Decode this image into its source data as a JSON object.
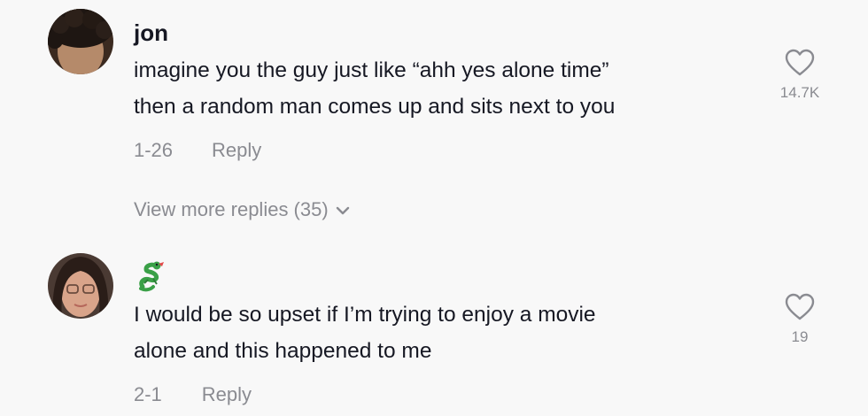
{
  "comments": [
    {
      "username": "jon",
      "text_lines": [
        "imagine you the guy just like “ahh yes alone time”",
        "then a random man comes up and sits next to you"
      ],
      "date": "1-26",
      "reply_label": "Reply",
      "like_count": "14.7K",
      "view_more_label": "View more replies (35)"
    },
    {
      "username_icon": "dragon-emoji",
      "text_lines": [
        "I would be so upset if I’m trying to enjoy a movie",
        "alone and this happened to me"
      ],
      "date": "2-1",
      "reply_label": "Reply",
      "like_count": "19"
    }
  ],
  "colors": {
    "background": "#f8f8f8",
    "primary_text": "#161823",
    "secondary_text": "#8a8b91"
  }
}
